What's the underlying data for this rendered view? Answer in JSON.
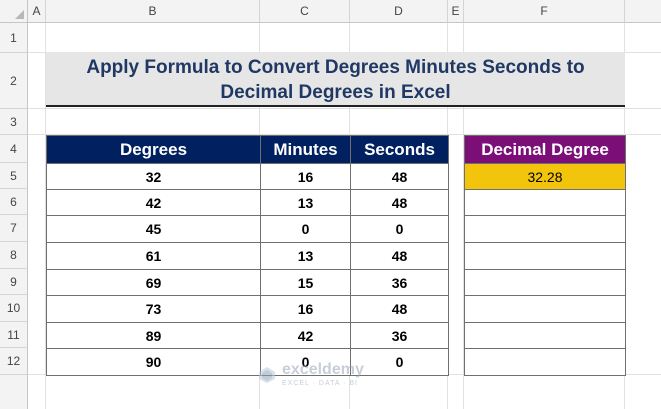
{
  "columns": [
    "A",
    "B",
    "C",
    "D",
    "E",
    "F"
  ],
  "rows": [
    "1",
    "2",
    "3",
    "4",
    "5",
    "6",
    "7",
    "8",
    "9",
    "10",
    "11",
    "12"
  ],
  "title": {
    "line1": "Apply Formula to Convert Degrees Minutes Seconds to",
    "line2": "Decimal Degrees in Excel"
  },
  "table": {
    "headers": [
      "Degrees",
      "Minutes",
      "Seconds"
    ],
    "rows": [
      [
        "32",
        "16",
        "48"
      ],
      [
        "42",
        "13",
        "48"
      ],
      [
        "45",
        "0",
        "0"
      ],
      [
        "61",
        "13",
        "48"
      ],
      [
        "69",
        "15",
        "36"
      ],
      [
        "73",
        "16",
        "48"
      ],
      [
        "89",
        "42",
        "36"
      ],
      [
        "90",
        "0",
        "0"
      ]
    ]
  },
  "decimal": {
    "header": "Decimal Degree",
    "values": [
      "32.28",
      "",
      "",
      "",
      "",
      "",
      "",
      ""
    ]
  },
  "watermark": {
    "name": "exceldemy",
    "tagline": "EXCEL · DATA · BI"
  },
  "colors": {
    "header_main": "#002060",
    "header_decimal": "#7b0e77",
    "highlight": "#f2c50c",
    "title_text": "#1f3864"
  }
}
